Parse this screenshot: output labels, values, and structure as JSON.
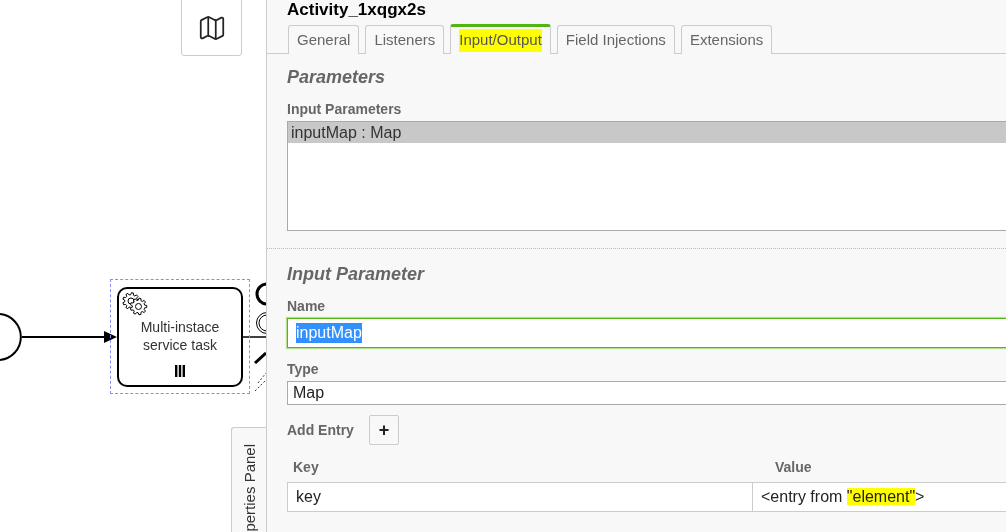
{
  "canvas": {
    "task": {
      "label": "Multi-instace service task",
      "selected": true
    },
    "panel_toggle": {
      "label": "perties Panel"
    }
  },
  "panel": {
    "title": "Activity_1xqgx2s",
    "tabs": [
      {
        "label": "General",
        "selected": false,
        "highlighted": false
      },
      {
        "label": "Listeners",
        "selected": false,
        "highlighted": false
      },
      {
        "label": "Input/Output",
        "selected": true,
        "highlighted": true
      },
      {
        "label": "Field Injections",
        "selected": false,
        "highlighted": false
      },
      {
        "label": "Extensions",
        "selected": false,
        "highlighted": false
      }
    ],
    "parameters": {
      "heading": "Parameters",
      "list_label": "Input Parameters",
      "items": [
        {
          "label": "inputMap : Map",
          "selected": true
        }
      ]
    },
    "input_parameter": {
      "heading": "Input Parameter",
      "name": {
        "label": "Name",
        "value": "inputMap",
        "focused": true,
        "text_selected": true
      },
      "type": {
        "label": "Type",
        "value": "Map"
      },
      "add_entry": {
        "label": "Add Entry",
        "button": "+"
      },
      "columns": [
        "Key",
        "Value"
      ],
      "rows": [
        {
          "key": "key",
          "value": [
            {
              "text": "<entry from ",
              "highlighted": false
            },
            {
              "text": "\"element\"",
              "highlighted": true
            },
            {
              "text": ">",
              "highlighted": false
            }
          ]
        }
      ]
    }
  }
}
